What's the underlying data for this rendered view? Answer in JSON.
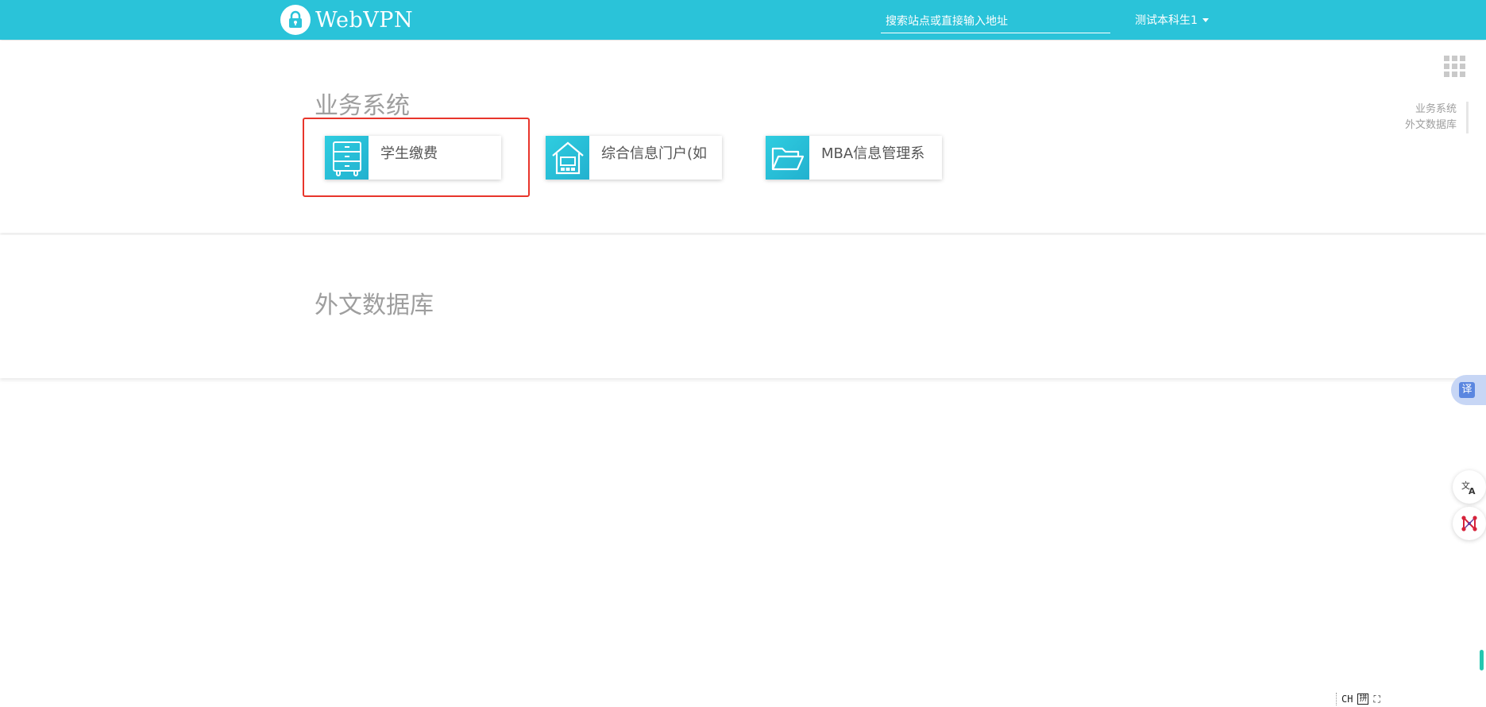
{
  "header": {
    "logo_text": "WebVPN",
    "search_placeholder": "搜索站点或直接输入地址",
    "user_name": "测试本科生1",
    "bg_color": "#2ac3d9"
  },
  "sections": [
    {
      "title": "业务系统",
      "cards": [
        {
          "label": "学生缴费",
          "icon": "cabinet-icon"
        },
        {
          "label": "综合信息门户(如",
          "icon": "house-icon"
        },
        {
          "label": "MBA信息管理系",
          "icon": "folder-open-icon"
        }
      ]
    },
    {
      "title": "外文数据库",
      "cards": []
    }
  ],
  "right_nav": {
    "items": [
      "业务系统",
      "外文数据库"
    ]
  },
  "floating": {
    "translate_label": "译"
  },
  "ime": {
    "mode": "CH",
    "pinyin": "拼"
  },
  "colors": {
    "accent": "#2ac3d9",
    "highlight_border": "#e8352b",
    "section_title": "#9e9e9e"
  }
}
